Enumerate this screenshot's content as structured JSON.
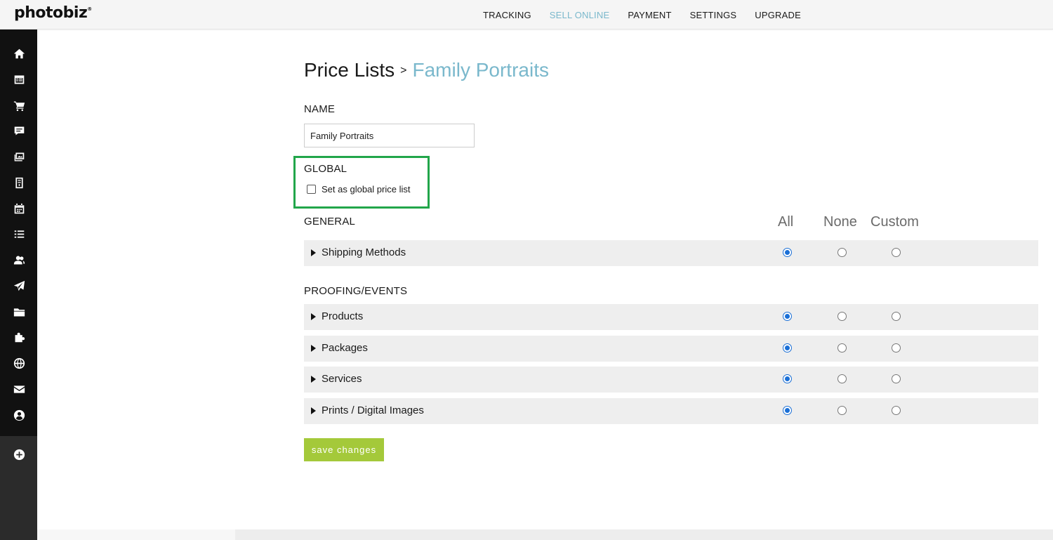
{
  "app": {
    "logo_text": "photobiz",
    "logo_mark": "®"
  },
  "topnav": {
    "items": [
      {
        "label": "TRACKING"
      },
      {
        "label": "SELL ONLINE",
        "active": true
      },
      {
        "label": "PAYMENT"
      },
      {
        "label": "SETTINGS"
      },
      {
        "label": "UPGRADE"
      }
    ]
  },
  "sidebar": {
    "icons": [
      "home-icon",
      "calendar-list-icon",
      "cart-icon",
      "chat-icon",
      "gallery-icon",
      "document-icon",
      "calendar-icon",
      "list-icon",
      "contacts-icon",
      "send-icon",
      "folder-icon",
      "puzzle-icon",
      "globe-icon",
      "mail-icon",
      "account-icon",
      "add-icon"
    ]
  },
  "breadcrumb": {
    "root": "Price Lists",
    "separator": ">",
    "current": "Family Portraits"
  },
  "name_section": {
    "label": "NAME",
    "value": "Family Portraits"
  },
  "global_section": {
    "label": "GLOBAL",
    "checkbox_label": "Set as global price list",
    "checked": false
  },
  "columns": {
    "all": "All",
    "none": "None",
    "custom": "Custom"
  },
  "general_section": {
    "label": "GENERAL",
    "rows": [
      {
        "label": "Shipping Methods",
        "selected": "all"
      }
    ]
  },
  "proofing_section": {
    "label": "PROOFING/EVENTS",
    "rows": [
      {
        "label": "Products",
        "selected": "all"
      },
      {
        "label": "Packages",
        "selected": "all"
      },
      {
        "label": "Services",
        "selected": "all"
      },
      {
        "label": "Prints / Digital Images",
        "selected": "all"
      }
    ]
  },
  "actions": {
    "save_label": "save changes"
  },
  "colors": {
    "accent_blue": "#7ab8cc",
    "radio_blue": "#1a6fd6",
    "save_green": "#a4c93a",
    "highlight_green": "#22a64a"
  }
}
